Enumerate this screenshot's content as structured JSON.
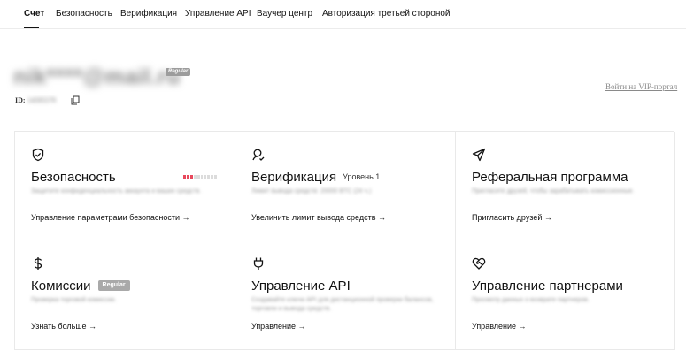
{
  "tabs": [
    {
      "label": "Счет",
      "active": true
    },
    {
      "label": "Безопасность",
      "active": false
    },
    {
      "label": "Верификация",
      "active": false
    },
    {
      "label": "Управление API",
      "active": false
    },
    {
      "label": "Ваучер центр",
      "active": false
    },
    {
      "label": "Авторизация третьей стороной",
      "active": false
    }
  ],
  "account": {
    "email": "nik****@mail.ru",
    "badge": "Regular",
    "uid_label": "ID:",
    "uid_value": "14595579",
    "vip_link": "Войти на VIP-портал"
  },
  "cards": [
    {
      "icon": "shield-check-icon",
      "title": "Безопасность",
      "desc": "Защитите конфиденциальность аккаунта и ваших средств.",
      "link": "Управление параметрами безопасности →",
      "security_level": 0.3,
      "meter_colors": {
        "filled": "#e8485c",
        "empty": "#dcdcdc"
      }
    },
    {
      "icon": "user-verify-icon",
      "title": "Верификация",
      "level": "Уровень 1",
      "desc": "Лимит вывода средств: 20000 BTC (24 ч.)",
      "link": "Увеличить лимит вывода средств →"
    },
    {
      "icon": "paper-plane-icon",
      "title": "Реферальная программа",
      "desc": "Пригласите друзей, чтобы зарабатывать комиссионные.",
      "link": "Пригласить друзей →"
    },
    {
      "icon": "dollar-icon",
      "title": "Комиссии",
      "badge": "Regular",
      "desc": "Проверка торговой комиссии.",
      "link": "Узнать больше →"
    },
    {
      "icon": "plug-icon",
      "title": "Управление API",
      "desc": "Создавайте ключи API для дистанционной проверки балансов, торговли и вывода средств.",
      "link": "Управление →"
    },
    {
      "icon": "heart-handshake-icon",
      "title": "Управление партнерами",
      "desc": "Просмотр данных о возврате партнеров.",
      "link": "Управление →"
    }
  ]
}
